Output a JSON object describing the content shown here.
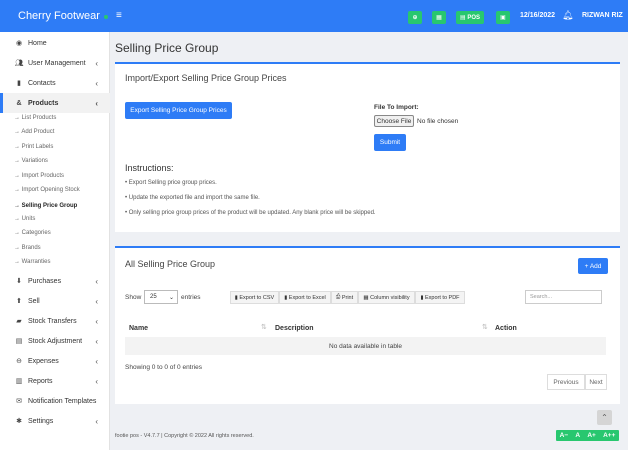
{
  "brand": {
    "name": "Cherry Footwear"
  },
  "topbar": {
    "pos_label": "POS",
    "date": "12/16/2022",
    "user": "RIZWAN RIZ"
  },
  "sidebar": {
    "home": "Home",
    "user_management": "User Management",
    "contacts": "Contacts",
    "products": "Products",
    "product_subs": [
      "List Products",
      "Add Product",
      "Print Labels",
      "Variations",
      "Import Products",
      "Import Opening Stock",
      "Selling Price Group",
      "Units",
      "Categories",
      "Brands",
      "Warranties"
    ],
    "purchases": "Purchases",
    "sell": "Sell",
    "stock_transfers": "Stock Transfers",
    "stock_adjustment": "Stock Adjustment",
    "expenses": "Expenses",
    "reports": "Reports",
    "notification_templates": "Notification Templates",
    "settings": "Settings"
  },
  "page": {
    "title": "Selling Price Group"
  },
  "import_card": {
    "title": "Import/Export Selling Price Group Prices",
    "export_button": "Export Selling Price Group Prices",
    "file_label": "File To Import:",
    "choose_file": "Choose File",
    "no_file": "No file chosen",
    "submit": "Submit",
    "instructions_title": "Instructions:",
    "instructions": [
      "• Export Selling price group prices.",
      "• Update the exported file and import the same file.",
      "• Only selling price group prices of the product will be updated. Any blank price will be skipped."
    ]
  },
  "list_card": {
    "title": "All Selling Price Group",
    "add_button": "+ Add",
    "show": "Show",
    "entries_value": "25",
    "entries": "entries",
    "exports": [
      "Export to CSV",
      "Export to Excel",
      "Print",
      "Column visibility",
      "Export to PDF"
    ],
    "search_placeholder": "Search...",
    "columns": [
      "Name",
      "Description",
      "Action"
    ],
    "no_data": "No data available in table",
    "info": "Showing 0 to 0 of 0 entries",
    "previous": "Previous",
    "next": "Next"
  },
  "footer": {
    "text": "footie pos - V4.7.7 | Copyright © 2022 All rights reserved."
  },
  "font_controls": {
    "decrease": "A−",
    "reset": "A",
    "increase": "A+",
    "increase_more": "A++"
  }
}
